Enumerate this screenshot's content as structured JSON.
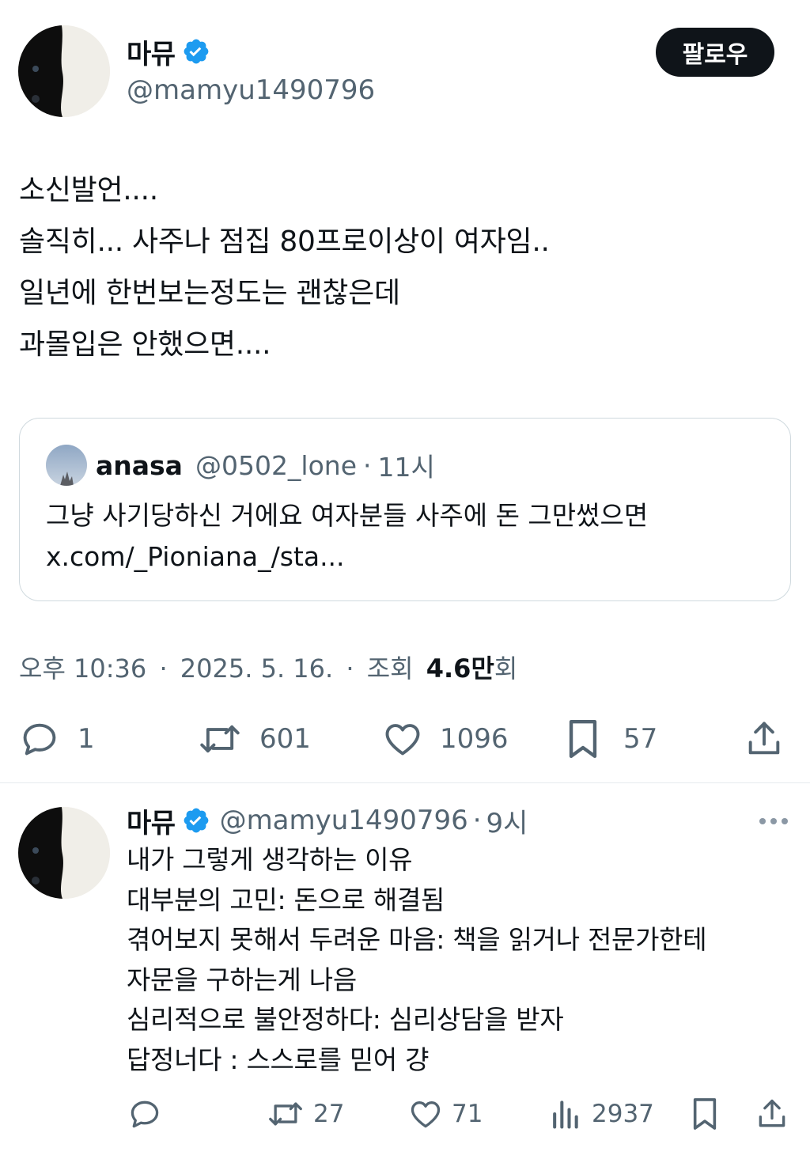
{
  "main_tweet": {
    "author": {
      "name": "마뮤",
      "handle": "@mamyu1490796"
    },
    "follow_label": "팔로우",
    "lines": [
      "소신발언....",
      "솔직히... 사주나 점집 80프로이상이 여자임..",
      "일년에 한번보는정도는 괜찮은데",
      "과몰입은 안했으면...."
    ],
    "quote": {
      "name": "anasa",
      "handle": "@0502_lone",
      "dot": "·",
      "time": "11시",
      "text": "그냥 사기당하신 거에요 여자분들 사주에 돈 그만썼으면",
      "link": "x.com/_Pioniana_/sta..."
    },
    "meta": {
      "time": "오후 10:36",
      "date": "2025. 5. 16.",
      "views_label": "조회",
      "views_value": "4.6만",
      "views_unit": "회",
      "sep": "·"
    },
    "actions": {
      "replies": "1",
      "retweets": "601",
      "likes": "1096",
      "bookmarks": "57"
    }
  },
  "reply_tweet": {
    "author": {
      "name": "마뮤",
      "handle": "@mamyu1490796"
    },
    "dot": "·",
    "time": "9시",
    "more_icon": "more-dots-icon",
    "lines": [
      "내가 그렇게 생각하는 이유",
      "대부분의 고민: 돈으로 해결됨",
      "겪어보지 못해서 두려운 마음: 책을 읽거나 전문가한테",
      "자문을 구하는게 나음",
      "심리적으로 불안정하다: 심리상담을 받자",
      "답정너다 : 스스로를 믿어 걍"
    ],
    "actions": {
      "retweets": "27",
      "likes": "71",
      "views": "2937"
    }
  },
  "colors": {
    "text": "#0f1419",
    "secondary": "#536471",
    "verified": "#1d9bf0",
    "follow_bg": "#0f1419",
    "border": "#cfd9de"
  }
}
